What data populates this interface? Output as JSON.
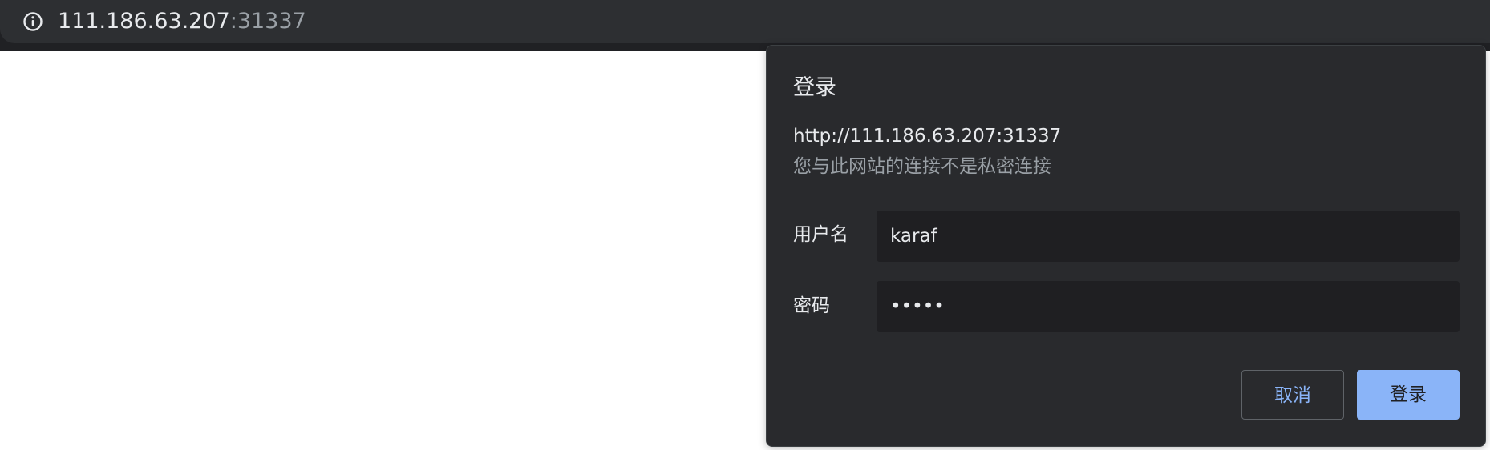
{
  "address_bar": {
    "icon": "info-icon",
    "host": "111.186.63.207",
    "port": ":31337"
  },
  "dialog": {
    "title": "登录",
    "url": "http://111.186.63.207:31337",
    "warning": "您与此网站的连接不是私密连接",
    "username_label": "用户名",
    "username_value": "karaf",
    "password_label": "密码",
    "password_value": "•••••",
    "cancel_label": "取消",
    "login_label": "登录"
  },
  "colors": {
    "toolbar": "#2d2f32",
    "dialog_bg": "#292a2d",
    "input_bg": "#1f1f22",
    "accent": "#8ab4f8",
    "text_primary": "#e8eaed",
    "text_secondary": "#9aa0a6"
  }
}
